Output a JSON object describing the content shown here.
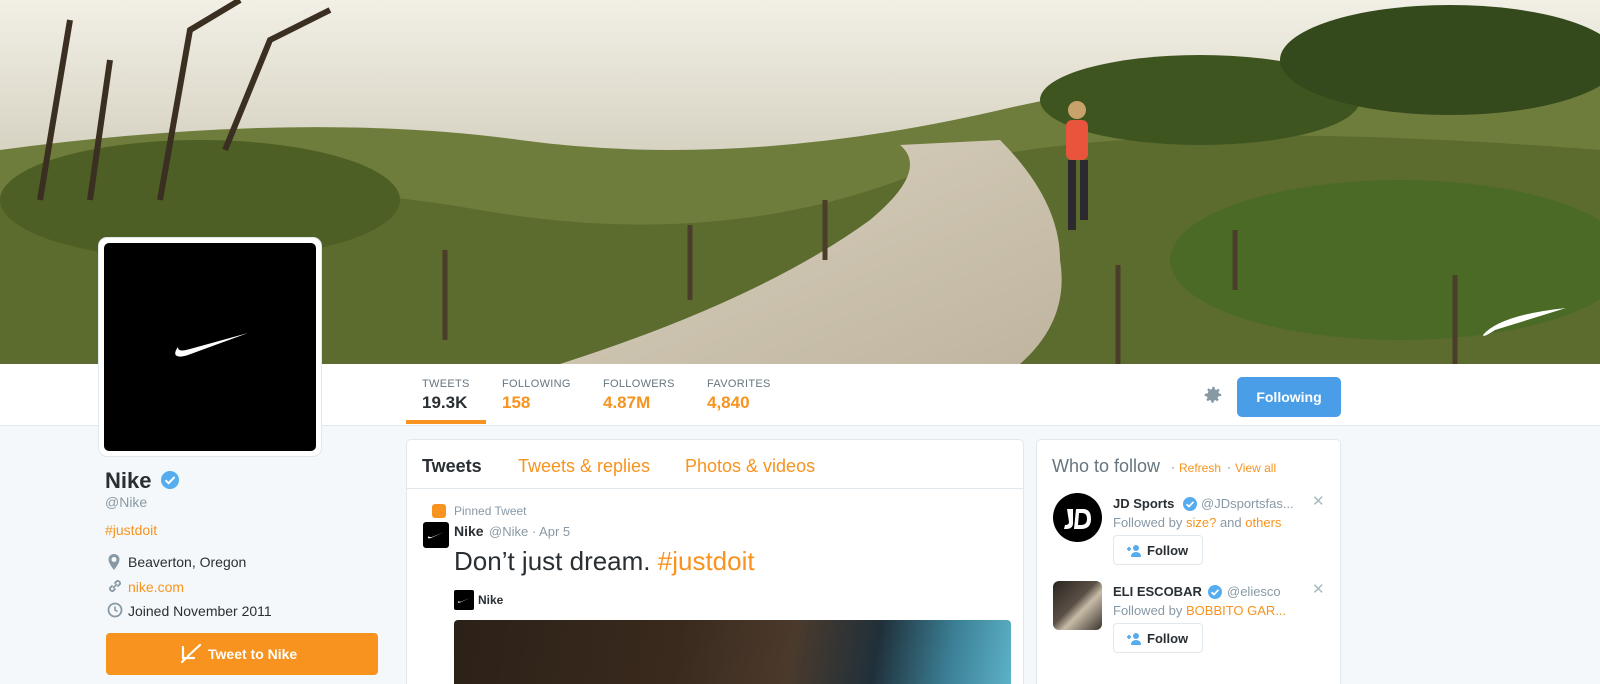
{
  "profile": {
    "name": "Nike",
    "handle": "@Nike",
    "bio_hashtag": "#justdoit",
    "location": "Beaverton, Oregon",
    "website": "nike.com",
    "joined": "Joined November 2011",
    "tweet_to_label": "Tweet to Nike"
  },
  "stats": [
    {
      "label": "TWEETS",
      "value": "19.3K"
    },
    {
      "label": "FOLLOWING",
      "value": "158"
    },
    {
      "label": "FOLLOWERS",
      "value": "4.87M"
    },
    {
      "label": "FAVORITES",
      "value": "4,840"
    }
  ],
  "follow_state_label": "Following",
  "timeline": {
    "tabs": [
      "Tweets",
      "Tweets & replies",
      "Photos & videos"
    ],
    "pinned_label": "Pinned Tweet",
    "tweet": {
      "author": "Nike",
      "meta": "@Nike · Apr 5",
      "text_plain": "Don’t just dream. ",
      "text_hashtag": "#justdoit",
      "card_name": "Nike"
    }
  },
  "who_to_follow": {
    "title": "Who to follow",
    "refresh": "Refresh",
    "view_all": "View all",
    "separator": "·",
    "users": [
      {
        "name": "JD Sports",
        "handle": "@JDsportsfas...",
        "followed_by_prefix": "Followed by ",
        "followed_by_1": "size?",
        "followed_by_mid": " and ",
        "followed_by_2": "others",
        "button": "Follow"
      },
      {
        "name": "ELI ESCOBAR",
        "handle": "@eliesco",
        "followed_by_prefix": "Followed by ",
        "followed_by_1": "BOBBITO GAR...",
        "followed_by_mid": "",
        "followed_by_2": "",
        "button": "Follow"
      }
    ]
  },
  "colors": {
    "accent": "#f7931e",
    "following_button": "#4a9ee8",
    "verified": "#55acee"
  },
  "icons": [
    "location-icon",
    "link-icon",
    "clock-icon",
    "gear-icon",
    "verified-icon",
    "quill-icon",
    "pin-icon",
    "add-user-icon",
    "close-icon",
    "swoosh-icon"
  ]
}
